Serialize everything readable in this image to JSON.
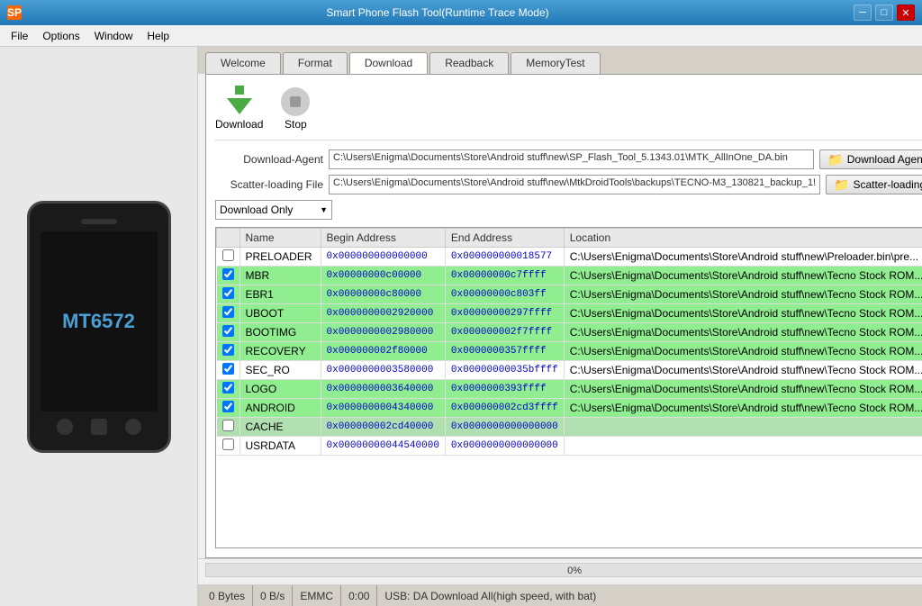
{
  "window": {
    "title": "Smart Phone Flash Tool(Runtime Trace Mode)",
    "icon": "SP"
  },
  "titlebar": {
    "minimize": "─",
    "restore": "□",
    "close": "✕"
  },
  "menubar": {
    "items": [
      "File",
      "Options",
      "Window",
      "Help"
    ]
  },
  "tabs": [
    {
      "label": "Welcome",
      "active": false
    },
    {
      "label": "Format",
      "active": false
    },
    {
      "label": "Download",
      "active": true
    },
    {
      "label": "Readback",
      "active": false
    },
    {
      "label": "MemoryTest",
      "active": false
    }
  ],
  "toolbar": {
    "download_label": "Download",
    "stop_label": "Stop"
  },
  "form": {
    "download_agent_label": "Download-Agent",
    "download_agent_value": "C:\\Users\\Enigma\\Documents\\Store\\Android stuff\\new\\SP_Flash_Tool_5.1343.01\\MTK_AllInOne_DA.bin",
    "download_agent_btn": "Download Agent",
    "scatter_label": "Scatter-loading File",
    "scatter_value": "C:\\Users\\Enigma\\Documents\\Store\\Android stuff\\new\\MtkDroidTools\\backups\\TECNO-M3_130821_backup_1!",
    "scatter_btn": "Scatter-loading",
    "dropdown_value": "Download Only",
    "dropdown_arrow": "▼"
  },
  "table": {
    "headers": [
      "",
      "Name",
      "Begin Address",
      "End Address",
      "Location"
    ],
    "rows": [
      {
        "checked": false,
        "name": "PRELOADER",
        "begin": "0x000000000000000",
        "end": "0x000000000018577",
        "location": "C:\\Users\\Enigma\\Documents\\Store\\Android stuff\\new\\Preloader.bin\\pre...",
        "style": "white"
      },
      {
        "checked": true,
        "name": "MBR",
        "begin": "0x00000000c00000",
        "end": "0x00000000c7ffff",
        "location": "C:\\Users\\Enigma\\Documents\\Store\\Android stuff\\new\\Tecno Stock ROM...",
        "style": "green"
      },
      {
        "checked": true,
        "name": "EBR1",
        "begin": "0x00000000c80000",
        "end": "0x00000000c803ff",
        "location": "C:\\Users\\Enigma\\Documents\\Store\\Android stuff\\new\\Tecno Stock ROM...",
        "style": "green"
      },
      {
        "checked": true,
        "name": "UBOOT",
        "begin": "0x0000000002920000",
        "end": "0x00000000297ffff",
        "location": "C:\\Users\\Enigma\\Documents\\Store\\Android stuff\\new\\Tecno Stock ROM...",
        "style": "green"
      },
      {
        "checked": true,
        "name": "BOOTIMG",
        "begin": "0x0000000002980000",
        "end": "0x000000002f7ffff",
        "location": "C:\\Users\\Enigma\\Documents\\Store\\Android stuff\\new\\Tecno Stock ROM...",
        "style": "green"
      },
      {
        "checked": true,
        "name": "RECOVERY",
        "begin": "0x000000002f80000",
        "end": "0x0000000357ffff",
        "location": "C:\\Users\\Enigma\\Documents\\Store\\Android stuff\\new\\Tecno Stock ROM...",
        "style": "green"
      },
      {
        "checked": true,
        "name": "SEC_RO",
        "begin": "0x0000000003580000",
        "end": "0x00000000035bffff",
        "location": "C:\\Users\\Enigma\\Documents\\Store\\Android stuff\\new\\Tecno Stock ROM...",
        "style": "white"
      },
      {
        "checked": true,
        "name": "LOGO",
        "begin": "0x0000000003640000",
        "end": "0x0000000393ffff",
        "location": "C:\\Users\\Enigma\\Documents\\Store\\Android stuff\\new\\Tecno Stock ROM...",
        "style": "green"
      },
      {
        "checked": true,
        "name": "ANDROID",
        "begin": "0x0000000004340000",
        "end": "0x000000002cd3ffff",
        "location": "C:\\Users\\Enigma\\Documents\\Store\\Android stuff\\new\\Tecno Stock ROM...",
        "style": "green"
      },
      {
        "checked": false,
        "name": "CACHE",
        "begin": "0x000000002cd40000",
        "end": "0x0000000000000000",
        "location": "",
        "style": "selected"
      },
      {
        "checked": false,
        "name": "USRDATA",
        "begin": "0x00000000044540000",
        "end": "0x0000000000000000",
        "location": "",
        "style": "white"
      }
    ]
  },
  "phone": {
    "brand": "MT6572"
  },
  "progress": {
    "label": "0%",
    "percent": 0
  },
  "statusbar": {
    "bytes": "0 Bytes",
    "speed": "0 B/s",
    "storage": "EMMC",
    "time": "0:00",
    "message": "USB: DA Download All(high speed, with bat)"
  }
}
